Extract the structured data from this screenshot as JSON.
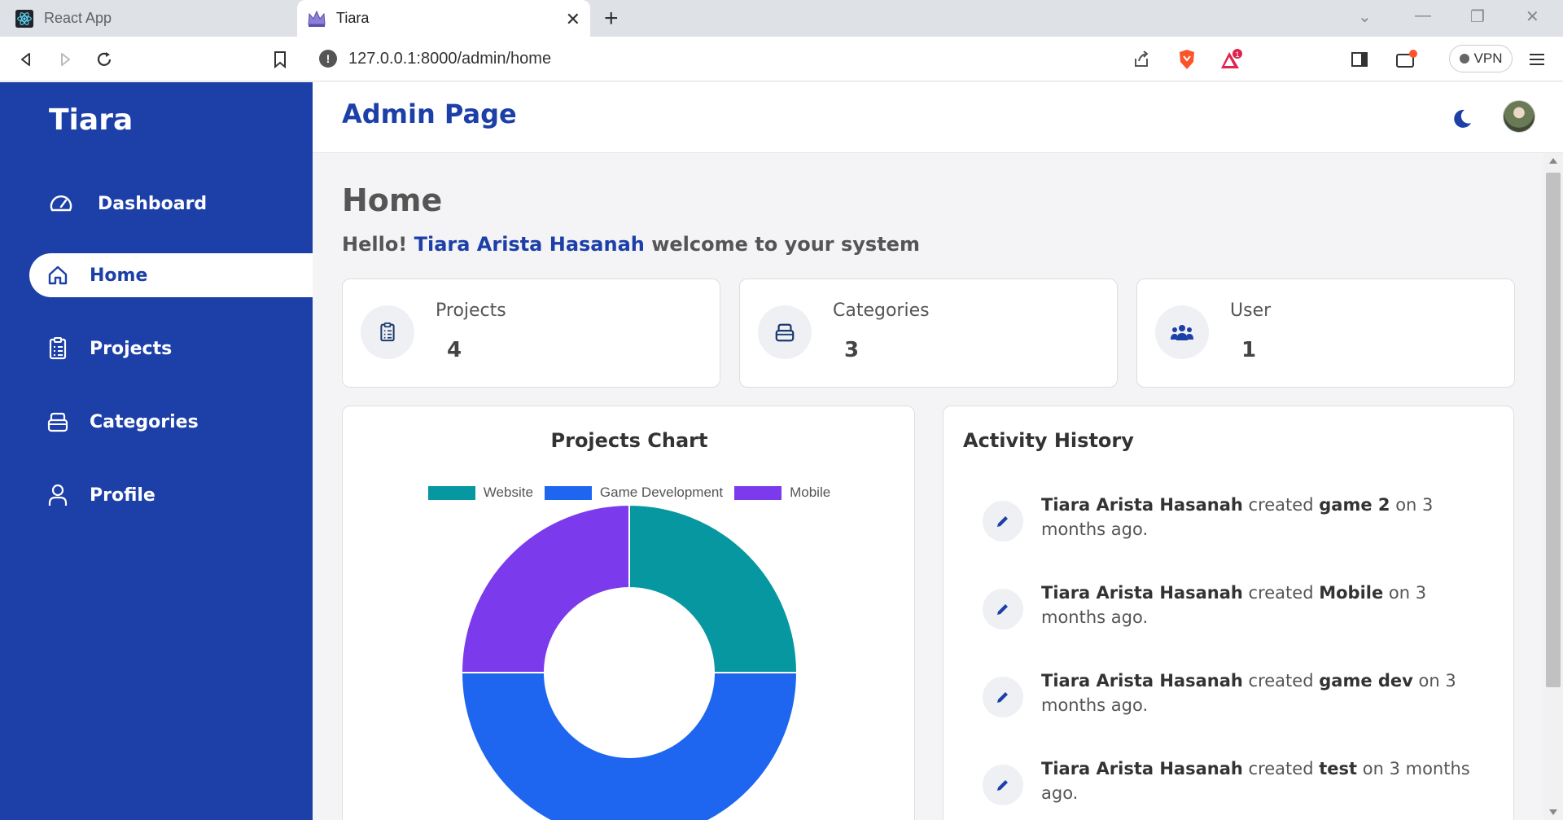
{
  "browser": {
    "tabs": [
      {
        "title": "React App",
        "icon": "react-icon",
        "active": false
      },
      {
        "title": "Tiara",
        "icon": "crown-icon",
        "active": true
      }
    ],
    "new_tab": "+",
    "close_tab": "✕",
    "url": "127.0.0.1:8000/admin/home",
    "vpn_label": "VPN",
    "brave_badge_count": "1"
  },
  "sidebar": {
    "brand": "Tiara",
    "items": [
      {
        "label": "Dashboard",
        "icon": "gauge-icon",
        "active": false
      },
      {
        "label": "Home",
        "icon": "home-icon",
        "active": true
      },
      {
        "label": "Projects",
        "icon": "clipboard-icon",
        "active": false
      },
      {
        "label": "Categories",
        "icon": "box-icon",
        "active": false
      },
      {
        "label": "Profile",
        "icon": "user-icon",
        "active": false
      }
    ]
  },
  "header": {
    "title": "Admin Page"
  },
  "main": {
    "heading": "Home",
    "greeting_prefix": "Hello!",
    "greeting_name": "Tiara Arista Hasanah",
    "greeting_suffix": "welcome to your system",
    "stats": [
      {
        "label": "Projects",
        "value": "4",
        "icon": "clipboard-icon"
      },
      {
        "label": "Categories",
        "value": "3",
        "icon": "box-icon"
      },
      {
        "label": "User",
        "value": "1",
        "icon": "users-icon"
      }
    ],
    "chart_title": "Projects Chart",
    "activity_title": "Activity History",
    "activities": [
      {
        "user": "Tiara Arista Hasanah",
        "action": "created",
        "item": "game 2",
        "suffix": "on 3 months ago."
      },
      {
        "user": "Tiara Arista Hasanah",
        "action": "created",
        "item": "Mobile",
        "suffix": "on 3 months ago."
      },
      {
        "user": "Tiara Arista Hasanah",
        "action": "created",
        "item": "game dev",
        "suffix": "on 3 months ago."
      },
      {
        "user": "Tiara Arista Hasanah",
        "action": "created",
        "item": "test",
        "suffix": "on 3 months ago."
      }
    ]
  },
  "colors": {
    "brand": "#1c3fa8",
    "website": "#0797a0",
    "game_development": "#1e66f0",
    "mobile": "#7c3aed"
  },
  "chart_data": {
    "type": "pie",
    "categories": [
      "Website",
      "Game Development",
      "Mobile"
    ],
    "values": [
      1,
      2,
      1
    ],
    "colors": [
      "#0797a0",
      "#1e66f0",
      "#7c3aed"
    ],
    "donut": true,
    "legend": "top"
  }
}
